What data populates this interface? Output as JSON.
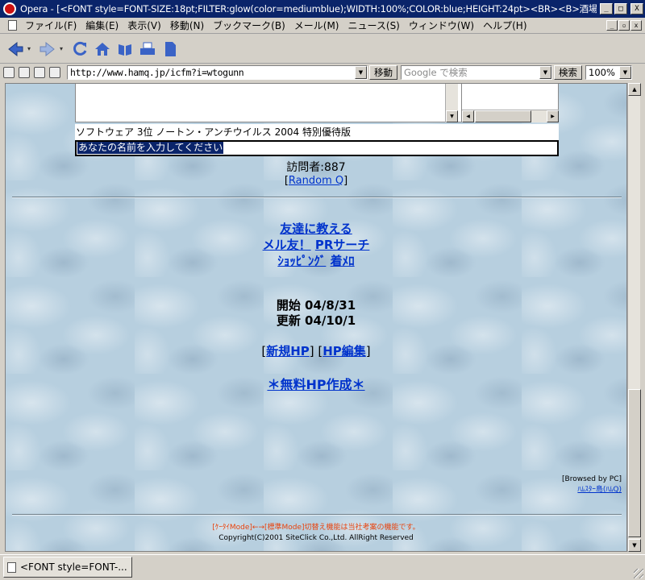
{
  "window": {
    "title": "Opera - [<FONT style=FONT-SIZE:18pt;FILTER:glow(color=mediumblue);WIDTH:100%;COLOR:blue;HEIGHT:24pt><BR><B>酒場</B></FONT...",
    "minimize": "_",
    "maximize": "□",
    "close": "X"
  },
  "menu": {
    "items": [
      "ファイル(F)",
      "編集(E)",
      "表示(V)",
      "移動(N)",
      "ブックマーク(B)",
      "メール(M)",
      "ニュース(S)",
      "ウィンドウ(W)",
      "ヘルプ(H)"
    ],
    "mdi": [
      "_",
      "▫",
      "x"
    ]
  },
  "toolbar": {
    "icons": [
      "back-arrow-icon",
      "forward-arrow-icon",
      "reload-icon",
      "home-icon",
      "hotlist-icon",
      "print-icon",
      "page-icon"
    ]
  },
  "address": {
    "url": "http://www.hamq.jp/icfm?i=wtogunn",
    "go_label": "移動",
    "search_placeholder": "Google で検索",
    "search_label": "検索",
    "zoom": "100%"
  },
  "page": {
    "software_text": "ソフトウェア 3位 ノートン・アンチウイルス 2004 特別優待版",
    "name_input_text": "あなたの名前を入力してください",
    "visitors": "訪問者:887",
    "random_link": "Random Q",
    "links": {
      "tell_friend": "友達に教える",
      "mail_friend": "メル友！",
      "pr_search": "PRサーチ",
      "shopping": "ｼｮｯﾋﾟﾝｸﾞ",
      "chaku_melo": "着ﾒﾛ"
    },
    "dates": {
      "start": "開始 04/8/31",
      "update": "更新 04/10/1"
    },
    "hp": {
      "new": "新規HP",
      "edit": "HP編集"
    },
    "free_hp": "＊無料HP作成＊",
    "browsed_by": "[Browsed by PC]",
    "hamster_link": "ﾊﾑｽﾀｰ島(ﾊﾑQ)",
    "footer": {
      "mode_switch": "[ｹｰﾀｲMode]←→[標準Mode]切替え機能は当社考案の機能です。",
      "copyright": "Copyright(C)2001 SiteClick Co.,Ltd. AllRight Reserved"
    }
  },
  "status": {
    "tab_label": "<FONT style=FONT-..."
  }
}
